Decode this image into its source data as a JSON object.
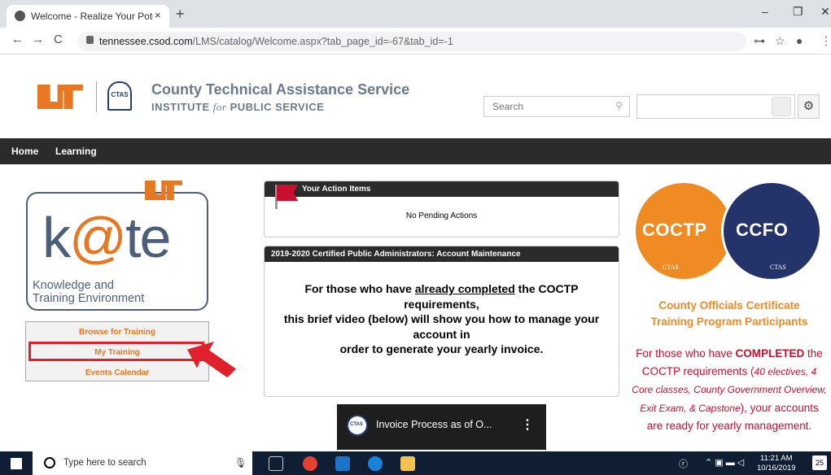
{
  "browser": {
    "tab_title": "Welcome - Realize Your Potential",
    "tab_close": "×",
    "new_tab": "+",
    "url_host": "tennessee.csod.com",
    "url_path": "/LMS/catalog/Welcome.aspx?tab_page_id=-67&tab_id=-1",
    "min": "–",
    "restore": "❐",
    "close": "✕",
    "back": "←",
    "forward": "→",
    "reload": "C"
  },
  "header": {
    "org_title": "County Technical Assistance Service",
    "org_sub_pre": "INSTITUTE ",
    "org_sub_for": "for",
    "org_sub_post": " PUBLIC SERVICE",
    "ctas_label": "CTAS",
    "search_placeholder": "Search"
  },
  "nav": {
    "home": "Home",
    "learning": "Learning"
  },
  "kate": {
    "logo_k": "k",
    "logo_at": "@",
    "logo_te": "te",
    "line1": "Knowledge and",
    "line2": "Training Environment"
  },
  "left_menu": {
    "browse": "Browse for Training",
    "my_training": "My Training",
    "events": "Events Calendar"
  },
  "action_items": {
    "title": "Your Action Items",
    "body": "No Pending Actions"
  },
  "cpa": {
    "title": "2019-2020 Certified Public Administrators: Account Maintenance",
    "l1_pre": "For those who have ",
    "l1_u": "already completed",
    "l1_post": " the COCTP",
    "l2": "requirements,",
    "l3": "this brief video (below) will show you how to manage your",
    "l4": "account in",
    "l5": "order to generate your yearly invoice."
  },
  "video": {
    "title": "Invoice Process as of O...",
    "more": "⋮",
    "logo": "CTAS"
  },
  "right": {
    "badge1": "COCTP",
    "badge2": "CCFO",
    "badge_sub": "CTAS",
    "heading1": "County Officials Certificate",
    "heading2": "Training Program Participants",
    "p_pre": "For those who have ",
    "p_bold": "COMPLETED",
    "p_mid": " the COCTP requirements (",
    "p_ital": "40 electives, 4 Core classes, County Government Overview, Exit Exam, & Capstone",
    "p_post": "), your accounts are ready for yearly management."
  },
  "taskbar": {
    "search_text": "Type here to search",
    "time": "11:21 AM",
    "date": "10/16/2019",
    "notif": "25"
  },
  "colors": {
    "orange": "#e87722",
    "navy": "#24346a",
    "red": "#c8102e",
    "dark": "#2b2b2b"
  }
}
